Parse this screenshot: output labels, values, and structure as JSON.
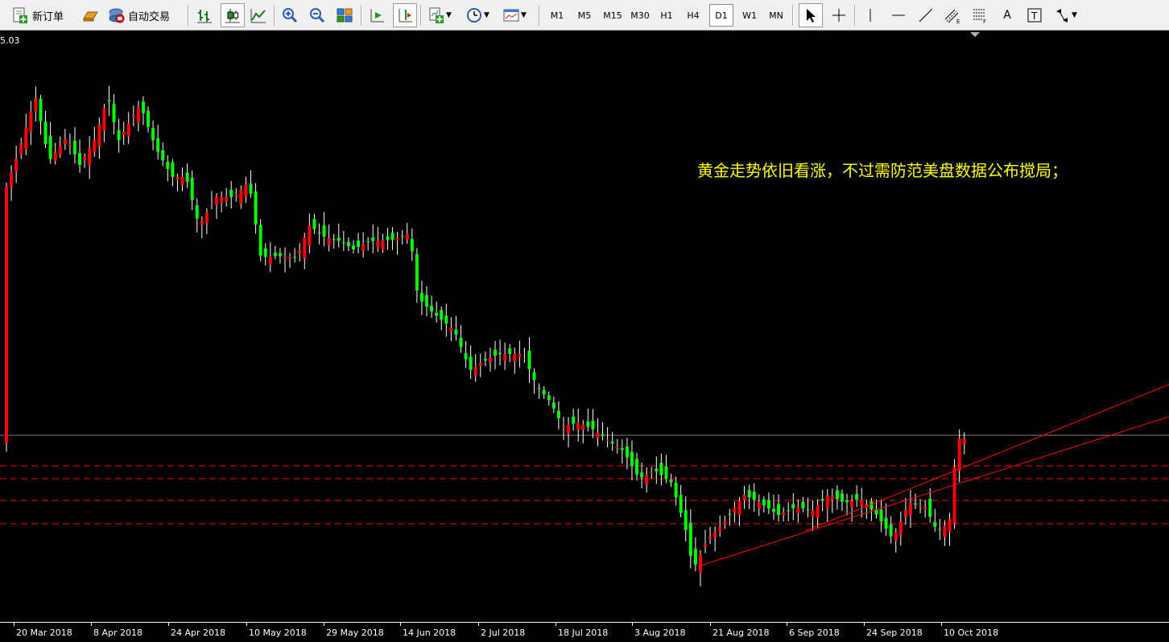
{
  "toolbar": {
    "new_order_label": "新订单",
    "auto_trading_label": "自动交易",
    "timeframes": [
      "M1",
      "M5",
      "M15",
      "M30",
      "H1",
      "H4",
      "D1",
      "W1",
      "MN"
    ],
    "active_timeframe": "D1",
    "text_tool_label": "A"
  },
  "chart": {
    "top_price_label": "5.03",
    "annotation": "黄金走势依旧看涨，不过需防范美盘数据公布搅局；",
    "x_labels": [
      "20 Mar 2018",
      "8 Apr 2018",
      "24 Apr 2018",
      "10 May 2018",
      "29 May 2018",
      "14 Jun 2018",
      "2 Jul 2018",
      "18 Jul 2018",
      "3 Aug 2018",
      "21 Aug 2018",
      "6 Sep 2018",
      "24 Sep 2018",
      "10 Oct 2018"
    ],
    "colors": {
      "background": "#000000",
      "bull_candle": "#ff0000",
      "bear_candle": "#00ff00",
      "wick": "#ffffff",
      "level_line": "#ff0000",
      "trend_line": "#ff0000",
      "bid_line": "#808080",
      "annotation": "#ffff00"
    }
  }
}
